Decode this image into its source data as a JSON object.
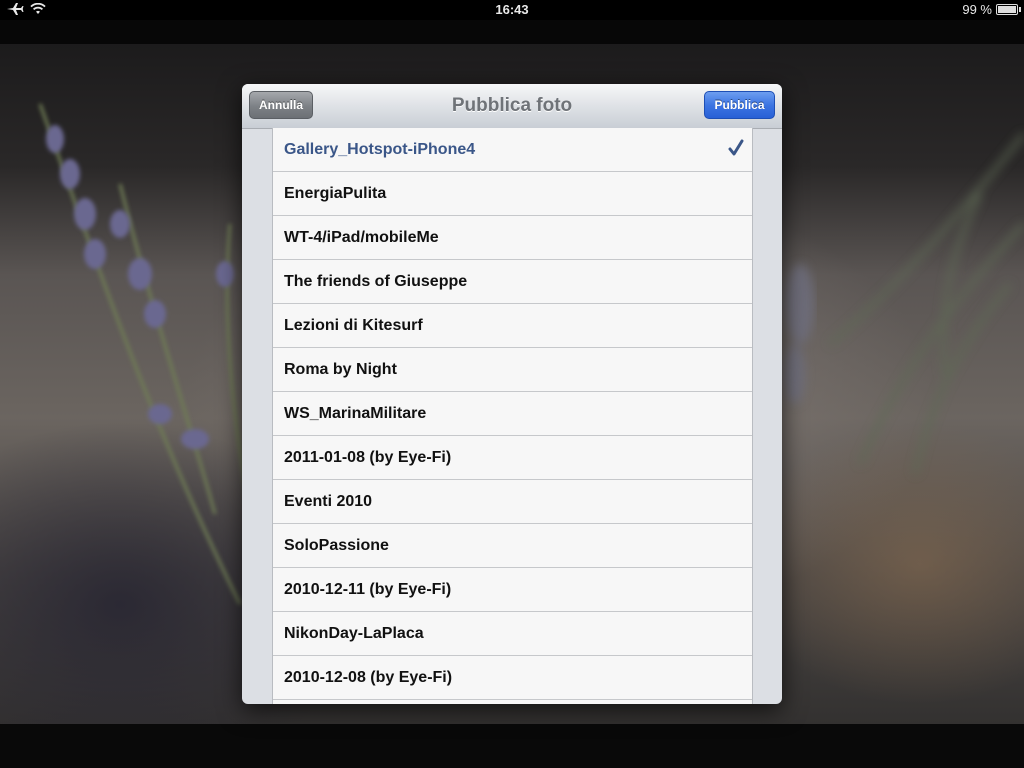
{
  "status_bar": {
    "time": "16:43",
    "battery": "99 %",
    "battery_level": 0.99,
    "icons": [
      "airplane-icon",
      "wifi-icon",
      "battery-icon"
    ]
  },
  "popover": {
    "title": "Pubblica foto",
    "cancel_label": "Annulla",
    "publish_label": "Pubblica",
    "colors": {
      "publish_button": "#3d75e2",
      "selected_text": "#3a5688"
    },
    "items": [
      {
        "label": "Gallery_Hotspot-iPhone4",
        "selected": true
      },
      {
        "label": "EnergiaPulita",
        "selected": false
      },
      {
        "label": "WT-4/iPad/mobileMe",
        "selected": false
      },
      {
        "label": "The friends of Giuseppe",
        "selected": false
      },
      {
        "label": "Lezioni di Kitesurf",
        "selected": false
      },
      {
        "label": "Roma by Night",
        "selected": false
      },
      {
        "label": "WS_MarinaMilitare",
        "selected": false
      },
      {
        "label": "2011-01-08 (by Eye-Fi)",
        "selected": false
      },
      {
        "label": "Eventi 2010",
        "selected": false
      },
      {
        "label": "SoloPassione",
        "selected": false
      },
      {
        "label": "2010-12-11 (by Eye-Fi)",
        "selected": false
      },
      {
        "label": "NikonDay-LaPlaca",
        "selected": false
      },
      {
        "label": "2010-12-08 (by Eye-Fi)",
        "selected": false
      }
    ]
  }
}
